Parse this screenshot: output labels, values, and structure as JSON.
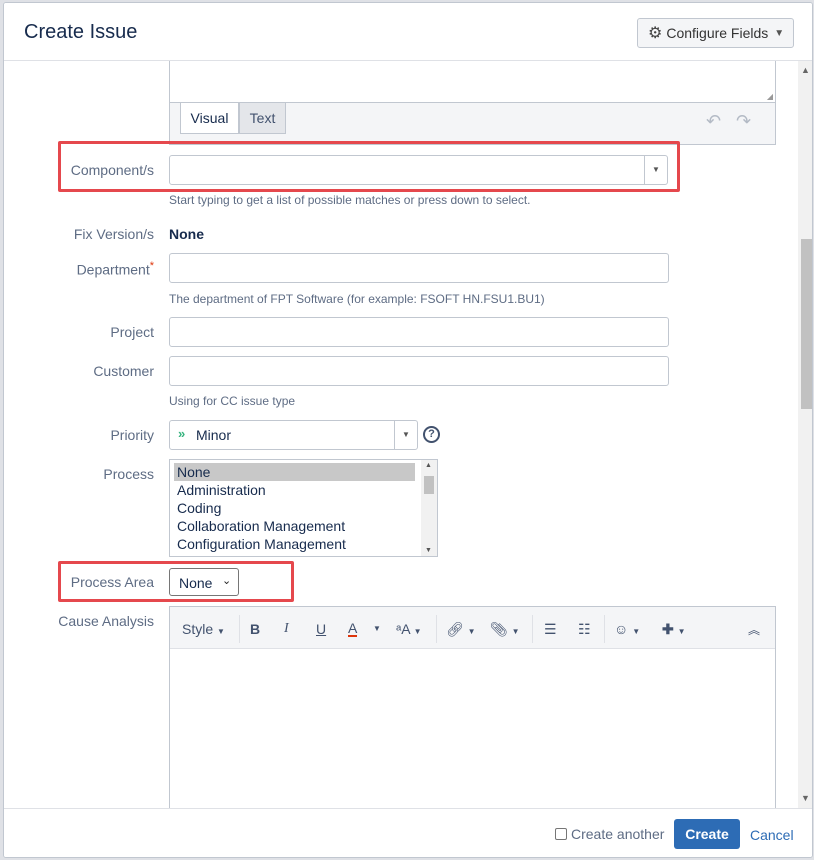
{
  "dialog": {
    "title": "Create Issue",
    "configure_fields_label": "Configure Fields"
  },
  "editor_tabs": {
    "visual": "Visual",
    "text": "Text"
  },
  "form": {
    "components": {
      "label": "Component/s",
      "value": "",
      "help": "Start typing to get a list of possible matches or press down to select."
    },
    "fix_versions": {
      "label": "Fix Version/s",
      "value": "None"
    },
    "department": {
      "label": "Department",
      "required_mark": "*",
      "value": "",
      "help": "The department of FPT Software (for example: FSOFT HN.FSU1.BU1)"
    },
    "project": {
      "label": "Project",
      "value": ""
    },
    "customer": {
      "label": "Customer",
      "value": "",
      "help": "Using for CC issue type"
    },
    "priority": {
      "label": "Priority",
      "value": "Minor",
      "icon_color": "#36b37e"
    },
    "process": {
      "label": "Process",
      "options": [
        "None",
        "Administration",
        "Coding",
        "Collaboration Management",
        "Configuration Management"
      ],
      "selected": "None"
    },
    "process_area": {
      "label": "Process Area",
      "value": "None"
    },
    "cause_analysis": {
      "label": "Cause Analysis",
      "style_label": "Style"
    }
  },
  "footer": {
    "create_another_label": "Create another",
    "create_label": "Create",
    "cancel_label": "Cancel"
  },
  "colors": {
    "accent": "#2d6cb5",
    "highlight": "#e5484d",
    "required": "#de350b"
  }
}
